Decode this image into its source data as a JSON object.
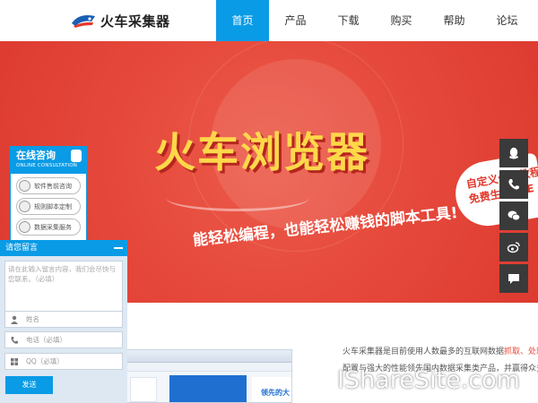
{
  "header": {
    "logo_text": "火车采集器",
    "nav": [
      {
        "label": "首页",
        "active": true
      },
      {
        "label": "产品",
        "active": false
      },
      {
        "label": "下载",
        "active": false
      },
      {
        "label": "购买",
        "active": false
      },
      {
        "label": "帮助",
        "active": false
      },
      {
        "label": "论坛",
        "active": false
      }
    ]
  },
  "banner": {
    "title": "火车浏览器",
    "subtitle": "能轻松编程，也能轻松赚钱的脚本工具!",
    "badge_line1": "自定义付费教程",
    "badge_line2": "免费生成EXE",
    "slides_total": 4,
    "active_slide": 1
  },
  "side_bar": {
    "icons": [
      "qq-icon",
      "phone-icon",
      "wechat-icon",
      "weibo-icon",
      "chat-icon"
    ],
    "bg_color": "#3a3a3a"
  },
  "consult": {
    "title": "在线咨询",
    "subtitle": "ONLINE CONSULTATION",
    "items": [
      "软件售前咨询",
      "规则脚本定制",
      "数据采集服务"
    ]
  },
  "message": {
    "title": "请您留言",
    "textarea_placeholder": "请在此输入留言内容，我们会尽快与您联系。（必填）",
    "name_placeholder": "姓名",
    "phone_placeholder": "电话（必填）",
    "qq_placeholder": "QQ（必填）",
    "send_label": "发送"
  },
  "content": {
    "intro_line1_a": "火车采集器是目前使用人数最多的互联网数据",
    "intro_line1_hl": "抓取、处理、分",
    "intro_line2": "配置与强大的性能领先国内数据采集类产品，并赢得众多用户",
    "screenshot_ad": "领先的大"
  },
  "watermark": "IShareSite.com",
  "colors": {
    "accent": "#0a9be6",
    "banner": "#e64a3c",
    "title_yellow": "#ffd84a"
  }
}
